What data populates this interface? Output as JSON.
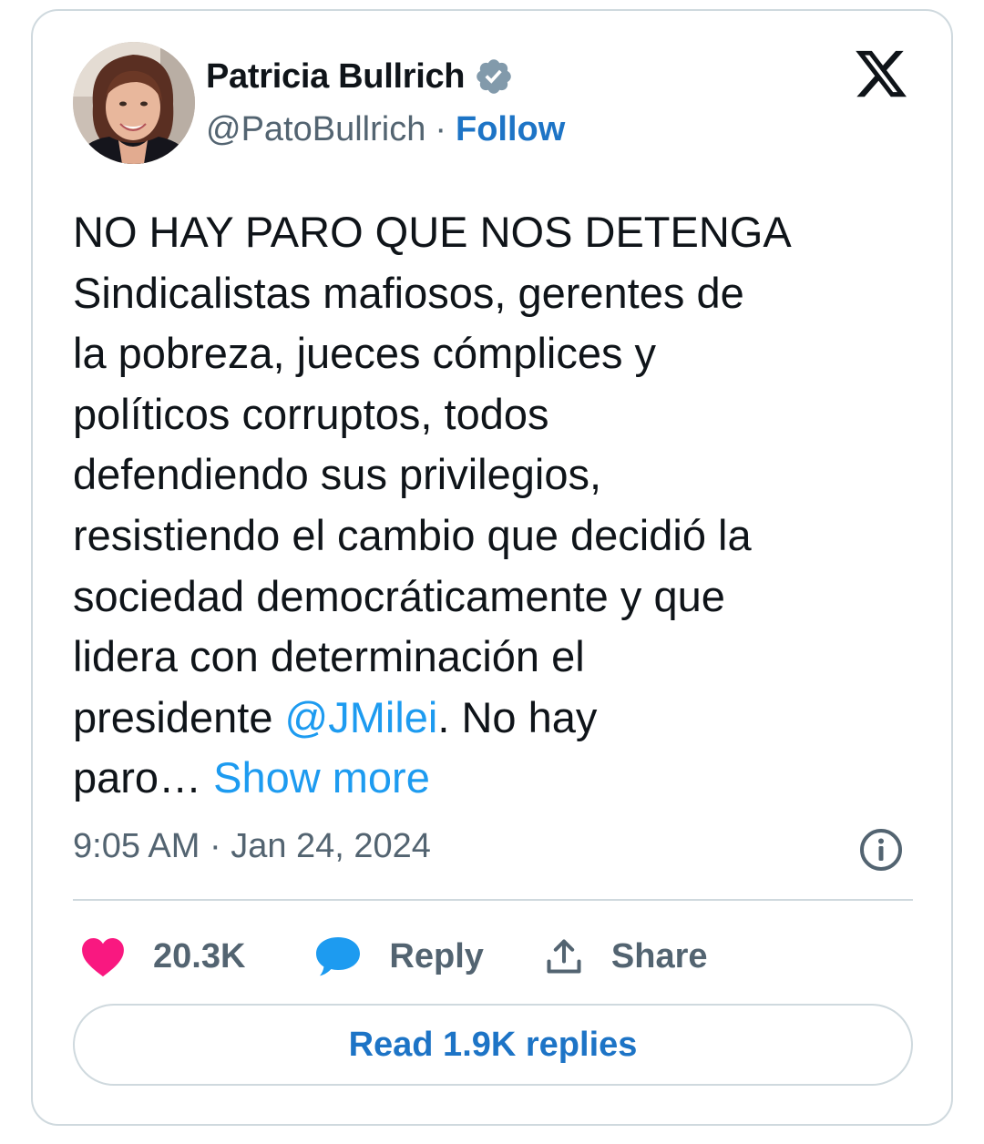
{
  "author": {
    "display_name": "Patricia Bullrich",
    "handle": "@PatoBullrich",
    "separator": "·",
    "follow_label": "Follow",
    "verified_icon": "verified-badge-icon",
    "avatar": "profile-photo"
  },
  "brand": {
    "logo_icon": "x-logo-icon"
  },
  "tweet": {
    "text_main": "NO HAY PARO QUE NOS DETENGA\nSindicalistas mafiosos, gerentes de\nla pobreza, jueces cómplices y\npolíticos corruptos, todos\ndefendiendo sus privilegios,\nresistiendo el cambio que decidió la\nsociedad democráticamente y que\nlidera con determinación el\npresidente ",
    "mention": "@JMilei",
    "text_after_mention": ". No hay\nparo… ",
    "show_more": "Show more",
    "timestamp": "9:05 AM · Jan 24, 2024",
    "info_icon": "info-icon"
  },
  "actions": {
    "like_count": "20.3K",
    "reply_label": "Reply",
    "share_label": "Share",
    "read_replies_label": "Read 1.9K replies"
  },
  "colors": {
    "like": "#f91880",
    "reply": "#1d9bf0",
    "link": "#1d9bf0",
    "follow": "#1d74c6",
    "verified": "#829aab",
    "border": "#cfd9de",
    "muted": "#536471"
  }
}
